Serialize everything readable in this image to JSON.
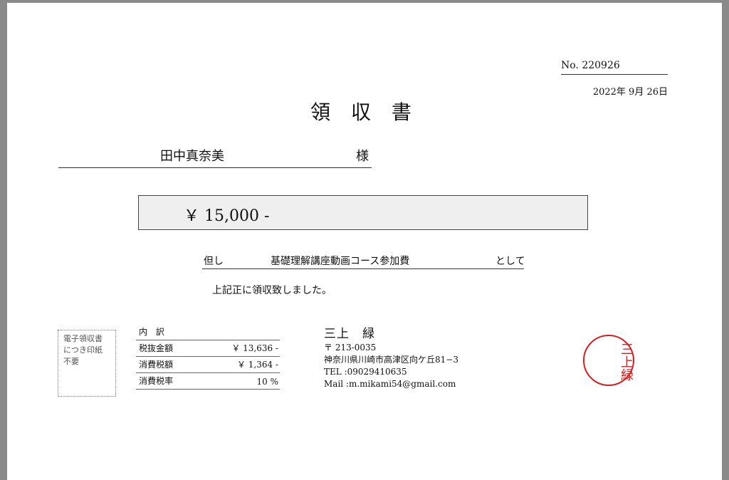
{
  "receipt": {
    "number": "No. 220926",
    "date": "2022年 9月 26日",
    "title": "領 収 書",
    "recipient_name": "田中真奈美",
    "honorific": "様",
    "amount": "￥ 15,000 -",
    "proviso_prefix": "但し",
    "proviso": "基礎理解講座動画コース参加費",
    "proviso_suffix": "として",
    "received_statement": "上記正に領収致しました。"
  },
  "stamp_note": {
    "lines": [
      "電子領収書",
      "につき印紙",
      "不要"
    ]
  },
  "breakdown": {
    "header": "内 訳",
    "rows": [
      {
        "label": "税抜金額",
        "value": "￥ 13,636 -"
      },
      {
        "label": "消費税額",
        "value": "￥ 1,364 -"
      },
      {
        "label": "消費税率",
        "value": "10 %"
      }
    ]
  },
  "issuer": {
    "name": "三上　緑",
    "postal": "〒 213-0035",
    "address": "神奈川県川崎市高津区向ケ丘81−3",
    "tel": "TEL :09029410635",
    "mail": "Mail :m.mikami54@gmail.com"
  },
  "seal": {
    "text": "三上緑",
    "color": "#d42020"
  }
}
